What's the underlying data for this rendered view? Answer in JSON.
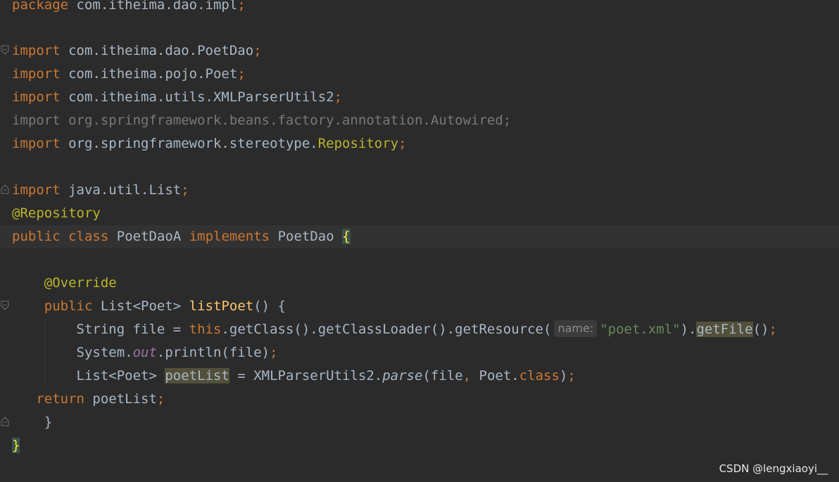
{
  "editor": {
    "lines": {
      "l1": {
        "package_kw": "package",
        "package_name": "com.itheima.dao.impl",
        "semi": ";"
      },
      "l3": {
        "import_kw": "import",
        "name": "com.itheima.dao.PoetDao",
        "semi": ";"
      },
      "l4": {
        "import_kw": "import",
        "name": "com.itheima.pojo.Poet",
        "semi": ";"
      },
      "l5": {
        "import_kw": "import",
        "name": "com.itheima.utils.XMLParserUtils2",
        "semi": ";"
      },
      "l6": {
        "text": "import org.springframework.beans.factory.annotation.Autowired;"
      },
      "l7": {
        "import_kw": "import",
        "name": "org.springframework.stereotype.",
        "name_highlight": "Repository",
        "semi": ";"
      },
      "l9": {
        "import_kw": "import",
        "name": "java.util.List",
        "semi": ";"
      },
      "l10": {
        "annotation": "@Repository"
      },
      "l11": {
        "public_kw": "public",
        "class_kw": "class",
        "class_name": "PoetDaoA",
        "implements_kw": "implements",
        "iface": "PoetDao",
        "open_brace": "{"
      },
      "l13": {
        "annotation": "@Override"
      },
      "l14": {
        "public_kw": "public",
        "ret_type": "List<Poet>",
        "method": "listPoet",
        "rest": "() {"
      },
      "l15": {
        "type": "String file = ",
        "this_kw": "this",
        "call1": ".getClass().getClassLoader().getResource(",
        "hint": "name:",
        "str": "\"poet.xml\"",
        "close": ").",
        "getfile": "getFile",
        "end": "()",
        "semi": ";"
      },
      "l16": {
        "prefix": "System.",
        "field": "out",
        "rest": ".println(file)",
        "semi": ";"
      },
      "l17": {
        "type": "List<Poet> ",
        "var": "poetList",
        "assign": " = XMLParserUtils2.",
        "parse": "parse",
        "args1": "(file",
        "comma": ",",
        "args2": " Poet.",
        "class_kw": "class",
        "close": ")",
        "semi": ";"
      },
      "l18": {
        "return_kw": "return",
        "var": " poetList",
        "semi": ";"
      },
      "l19": {
        "brace": "}"
      },
      "l20": {
        "brace": "}"
      }
    }
  },
  "watermark": "CSDN @lengxiaoyi__",
  "colors": {
    "background": "#2b2b2b",
    "keyword": "#cc7832",
    "annotation": "#bbb529",
    "function": "#ffc66d",
    "string": "#6a8759",
    "static_field": "#9876aa",
    "default": "#a9b7c6"
  }
}
